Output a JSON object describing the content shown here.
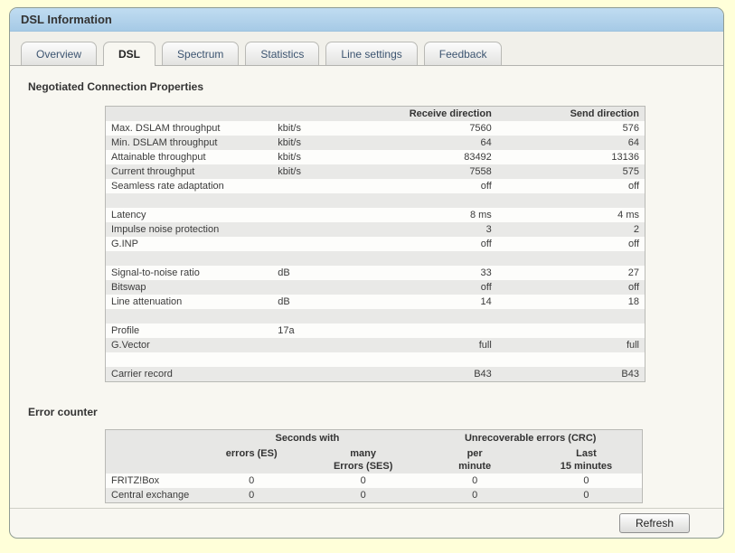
{
  "window": {
    "title": "DSL Information"
  },
  "tabs": [
    {
      "label": "Overview",
      "active": false
    },
    {
      "label": "DSL",
      "active": true
    },
    {
      "label": "Spectrum",
      "active": false
    },
    {
      "label": "Statistics",
      "active": false
    },
    {
      "label": "Line settings",
      "active": false
    },
    {
      "label": "Feedback",
      "active": false
    }
  ],
  "connection": {
    "heading": "Negotiated Connection Properties",
    "columns": {
      "receive": "Receive direction",
      "send": "Send direction"
    },
    "rows": [
      {
        "label": "Max. DSLAM throughput",
        "unit": "kbit/s",
        "receive": "7560",
        "send": "576"
      },
      {
        "label": "Min. DSLAM throughput",
        "unit": "kbit/s",
        "receive": "64",
        "send": "64"
      },
      {
        "label": "Attainable throughput",
        "unit": "kbit/s",
        "receive": "83492",
        "send": "13136"
      },
      {
        "label": "Current throughput",
        "unit": "kbit/s",
        "receive": "7558",
        "send": "575"
      },
      {
        "label": "Seamless rate adaptation",
        "unit": "",
        "receive": "off",
        "send": "off"
      },
      {
        "label": "Latency",
        "unit": "",
        "receive": "8 ms",
        "send": "4 ms"
      },
      {
        "label": "Impulse noise protection",
        "unit": "",
        "receive": "3",
        "send": "2"
      },
      {
        "label": "G.INP",
        "unit": "",
        "receive": "off",
        "send": "off"
      },
      {
        "label": "Signal-to-noise ratio",
        "unit": "dB",
        "receive": "33",
        "send": "27"
      },
      {
        "label": "Bitswap",
        "unit": "",
        "receive": "off",
        "send": "off"
      },
      {
        "label": "Line attenuation",
        "unit": "dB",
        "receive": "14",
        "send": "18"
      },
      {
        "label": "Profile",
        "unit": "17a",
        "receive": "",
        "send": ""
      },
      {
        "label": "G.Vector",
        "unit": "",
        "receive": "full",
        "send": "full"
      },
      {
        "label": "Carrier record",
        "unit": "",
        "receive": "B43",
        "send": "B43"
      }
    ]
  },
  "error_counter": {
    "heading": "Error counter",
    "group_headers": {
      "seconds": "Seconds with",
      "crc": "Unrecoverable errors (CRC)"
    },
    "col_headers": [
      {
        "line1": "errors (ES)",
        "line2": ""
      },
      {
        "line1": "many",
        "line2": "Errors (SES)"
      },
      {
        "line1": "per",
        "line2": "minute"
      },
      {
        "line1": "Last",
        "line2": "15 minutes"
      }
    ],
    "rows": [
      {
        "label": "FRITZ!Box",
        "values": [
          "0",
          "0",
          "0",
          "0"
        ]
      },
      {
        "label": "Central exchange",
        "values": [
          "0",
          "0",
          "0",
          "0"
        ]
      }
    ]
  },
  "footer": {
    "refresh_label": "Refresh"
  },
  "colors": {
    "page_background": "#ffffd9",
    "titlebar_top": "#c0dcf1",
    "titlebar_bottom": "#a6cae6",
    "panel_background": "#f8f7f1",
    "row_stripe": "#e9e9e7",
    "panel_border": "#8f9c92"
  }
}
